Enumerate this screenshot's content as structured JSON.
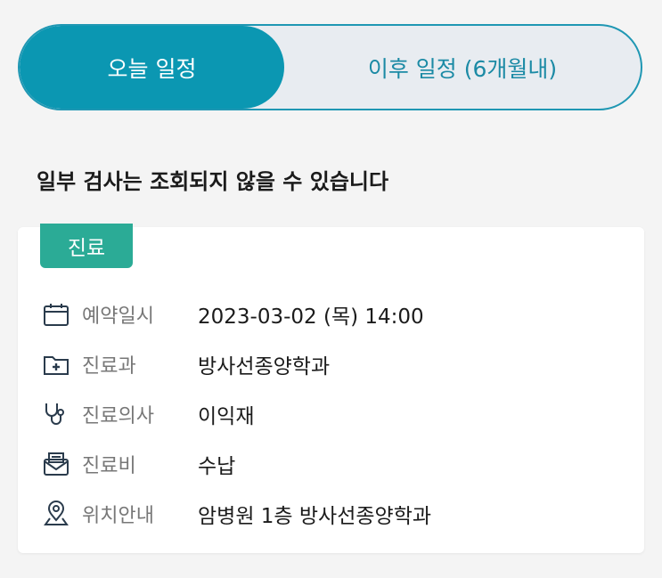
{
  "tabs": {
    "today": "오늘 일정",
    "upcoming": "이후 일정 (6개월내)"
  },
  "notice": "일부 검사는 조회되지 않을 수 있습니다",
  "card": {
    "badge": "진료",
    "rows": [
      {
        "icon": "calendar-icon",
        "label": "예약일시",
        "value": "2023-03-02 (목) 14:00"
      },
      {
        "icon": "medical-folder-icon",
        "label": "진료과",
        "value": "방사선종양학과"
      },
      {
        "icon": "stethoscope-icon",
        "label": "진료의사",
        "value": "이익재"
      },
      {
        "icon": "envelope-icon",
        "label": "진료비",
        "value": "수납"
      },
      {
        "icon": "location-pin-icon",
        "label": "위치안내",
        "value": "암병원 1층 방사선종양학과"
      }
    ]
  },
  "colors": {
    "accent": "#0b97b2",
    "badge": "#2bab96",
    "icon": "#2a3b4c"
  }
}
